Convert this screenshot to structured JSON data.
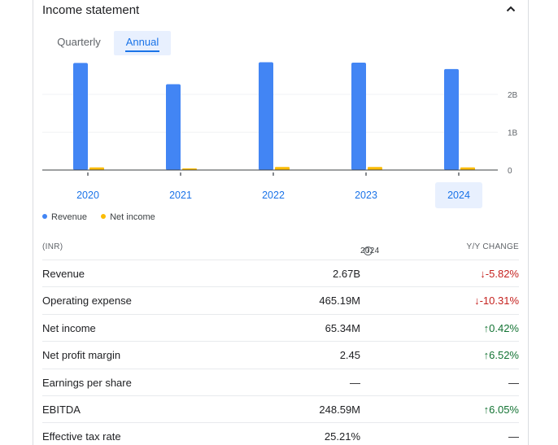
{
  "header": {
    "title": "Income statement"
  },
  "tabs": {
    "quarterly": "Quarterly",
    "annual": "Annual"
  },
  "chart_data": {
    "type": "bar",
    "categories": [
      "2020",
      "2021",
      "2022",
      "2023",
      "2024"
    ],
    "selected_category": "2024",
    "series": [
      {
        "name": "Revenue",
        "color": "#4285f4",
        "values": [
          2.83,
          2.27,
          2.85,
          2.84,
          2.67
        ]
      },
      {
        "name": "Net income",
        "color": "#fbbc04",
        "values": [
          0.07,
          0.03,
          0.08,
          0.08,
          0.07
        ]
      }
    ],
    "yticks": [
      "2B",
      "1B",
      "0"
    ],
    "ylim": [
      0,
      3
    ],
    "unit": "B",
    "grid": true,
    "legend_position": "bottom-left"
  },
  "legend": {
    "revenue": "Revenue",
    "net_income": "Net income"
  },
  "table": {
    "col_label": "(INR)",
    "col_year": "2024",
    "col_change": "Y/Y CHANGE",
    "rows": [
      {
        "label": "Revenue",
        "value": "2.67B",
        "change": "-5.82%",
        "dir": "down"
      },
      {
        "label": "Operating expense",
        "value": "465.19M",
        "change": "-10.31%",
        "dir": "down"
      },
      {
        "label": "Net income",
        "value": "65.34M",
        "change": "0.42%",
        "dir": "up"
      },
      {
        "label": "Net profit margin",
        "value": "2.45",
        "change": "6.52%",
        "dir": "up"
      },
      {
        "label": "Earnings per share",
        "value": "—",
        "change": "—",
        "dir": "none"
      },
      {
        "label": "EBITDA",
        "value": "248.59M",
        "change": "6.05%",
        "dir": "up"
      },
      {
        "label": "Effective tax rate",
        "value": "25.21%",
        "change": "—",
        "dir": "none"
      }
    ]
  }
}
